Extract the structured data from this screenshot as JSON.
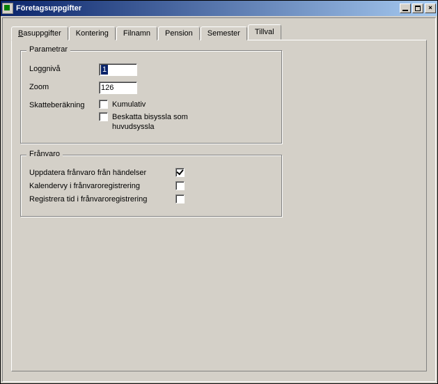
{
  "window": {
    "title": "Företagsuppgifter"
  },
  "tabs": [
    {
      "label_prefix": "B",
      "label_rest": "asuppgifter",
      "has_underline": true
    },
    {
      "label": "Kontering"
    },
    {
      "label": "Filnamn"
    },
    {
      "label": "Pension"
    },
    {
      "label": "Semester"
    },
    {
      "label": "Tillval",
      "active": true
    }
  ],
  "param": {
    "legend": "Parametrar",
    "loggniva_label": "Loggnivå",
    "loggniva_value": "1",
    "zoom_label": "Zoom",
    "zoom_value": "126",
    "skatteberakning_label": "Skatteberäkning",
    "kumulativ_label": "Kumulativ",
    "kumulativ_checked": false,
    "beskatta_label": "Beskatta bisyssla som huvudsyssla",
    "beskatta_checked": false
  },
  "franvaro": {
    "legend": "Frånvaro",
    "rows": [
      {
        "label": "Uppdatera frånvaro från händelser",
        "checked": true
      },
      {
        "label": "Kalendervy i frånvaroregistrering",
        "checked": false
      },
      {
        "label": "Registrera tid i frånvaroregistrering",
        "checked": false
      }
    ]
  }
}
